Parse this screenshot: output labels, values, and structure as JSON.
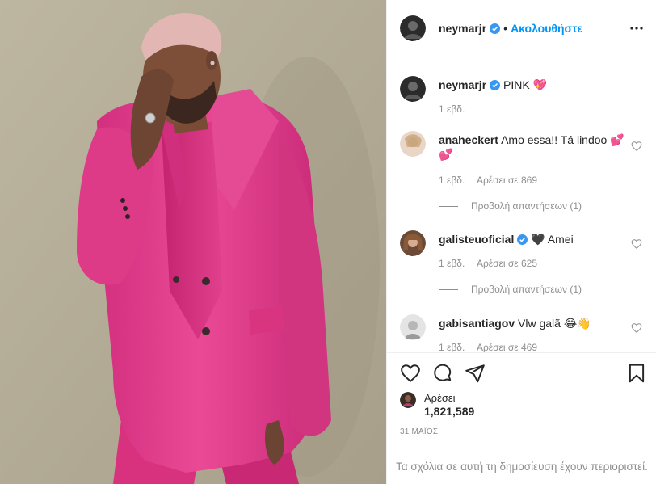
{
  "post": {
    "image_alt": "Man in pink suit",
    "header": {
      "username": "neymarjr",
      "separator": "•",
      "follow_label": "Ακολουθήστε",
      "more_icon": "more-options-icon"
    },
    "caption": {
      "username": "neymarjr",
      "text": "PINK 💖",
      "time": "1 εβδ."
    },
    "comments": [
      {
        "username": "anaheckert",
        "text": "Amo essa!! Tá lindoo 💕💕",
        "time": "1 εβδ.",
        "likes": "Αρέσει σε 869",
        "replies": "Προβολή απαντήσεων (1)",
        "verified": false
      },
      {
        "username": "galisteuoficial",
        "text": "🖤 Amei",
        "time": "1 εβδ.",
        "likes": "Αρέσει σε 625",
        "replies": "Προβολή απαντήσεων (1)",
        "verified": true
      },
      {
        "username": "gabisantiagov",
        "text": "Vlw galã 😂👋",
        "time": "1 εβδ.",
        "likes": "Αρέσει σε 469",
        "verified": false
      }
    ],
    "actions": {
      "like_icon": "heart-icon",
      "comment_icon": "comment-icon",
      "share_icon": "share-icon",
      "save_icon": "bookmark-icon"
    },
    "likes_label": "Αρέσει",
    "likes_count": "1,821,589",
    "date": "31 ΜΑΪΟΣ",
    "comments_restricted": "Τα σχόλια σε αυτή τη δημοσίευση έχουν περιοριστεί.",
    "colors": {
      "link_blue": "#0095f6",
      "verified_blue": "#3897f0",
      "suit_pink": "#e63d8c",
      "muted_text": "#8e8e8e"
    }
  }
}
